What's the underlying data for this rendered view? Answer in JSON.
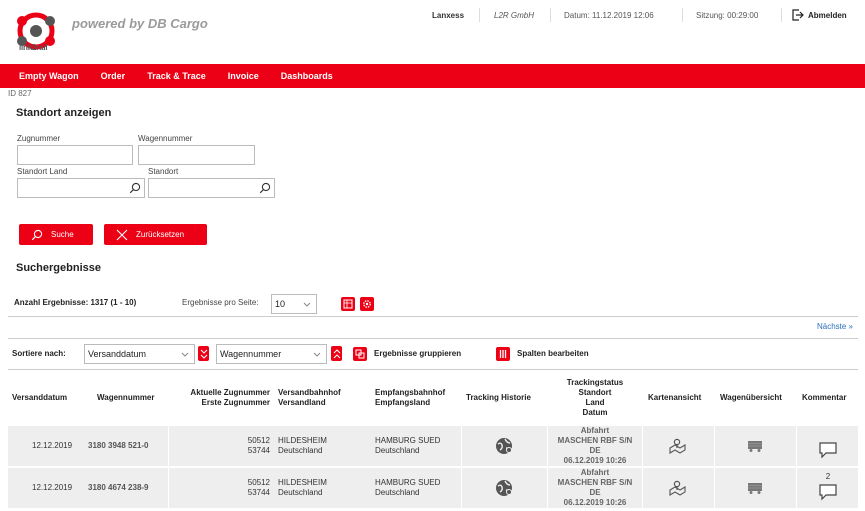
{
  "header": {
    "logo_text": "link2rail",
    "powered_by": "powered by DB Cargo",
    "company": "Lanxess",
    "subcompany": "L2R GmbH",
    "date_label": "Datum: 11.12.2019 12:06",
    "session_label": "Sitzung:  00:29:00",
    "logout_label": "Abmelden"
  },
  "nav": [
    "Empty Wagon",
    "Order",
    "Track & Trace",
    "Invoice",
    "Dashboards"
  ],
  "page_id": "ID 827",
  "search": {
    "title": "Standort anzeigen",
    "zugnummer_label": "Zugnummer",
    "wagennummer_label": "Wagennummer",
    "standort_land_label": "Standort Land",
    "standort_label": "Standort",
    "search_button": "Suche",
    "reset_button": "Zurücksetzen"
  },
  "results": {
    "title": "Suchergebnisse",
    "count_label": "Anzahl Ergebnisse: 1317 (1 - 10)",
    "per_page_label": "Ergebnisse pro Seite:",
    "per_page_value": "10",
    "next_label": "Nächste »",
    "sort_label": "Sortiere nach:",
    "sort1_value": "Versanddatum",
    "sort2_value": "Wagennummer",
    "group_label": "Ergebnisse gruppieren",
    "columns_label": "Spalten bearbeiten"
  },
  "table": {
    "headers": {
      "versanddatum": "Versanddatum",
      "wagennummer": "Wagennummer",
      "zug1": "Aktuelle Zugnummer",
      "zug2": "Erste Zugnummer",
      "vb1": "Versandbahnhof",
      "vb2": "Versandland",
      "eb1": "Empfangsbahnhof",
      "eb2": "Empfangsland",
      "tracking_historie": "Tracking Historie",
      "ts1": "Trackingstatus",
      "ts2": "Standort",
      "ts3": "Land",
      "ts4": "Datum",
      "karte": "Kartenansicht",
      "wagen": "Wagenübersicht",
      "kommentar": "Kommentar"
    },
    "rows": [
      {
        "date": "12.12.2019",
        "wagon": "3180 3948 521-0",
        "zug_aktuell": "50512",
        "zug_erste": "53744",
        "vb": "HILDESHEIM",
        "vland": "Deutschland",
        "eb": "HAMBURG SUED",
        "eland": "Deutschland",
        "status": "Abfahrt",
        "standort": "MASCHEN RBF S/N",
        "land": "DE",
        "datum": "06.12.2019 10:26",
        "comment_count": ""
      },
      {
        "date": "12.12.2019",
        "wagon": "3180 4674 238-9",
        "zug_aktuell": "50512",
        "zug_erste": "53744",
        "vb": "HILDESHEIM",
        "vland": "Deutschland",
        "eb": "HAMBURG SUED",
        "eland": "Deutschland",
        "status": "Abfahrt",
        "standort": "MASCHEN RBF S/N",
        "land": "DE",
        "datum": "06.12.2019 10:26",
        "comment_count": "2"
      }
    ]
  },
  "colors": {
    "accent": "#ec0016",
    "row_bg": "#eeeeee"
  }
}
